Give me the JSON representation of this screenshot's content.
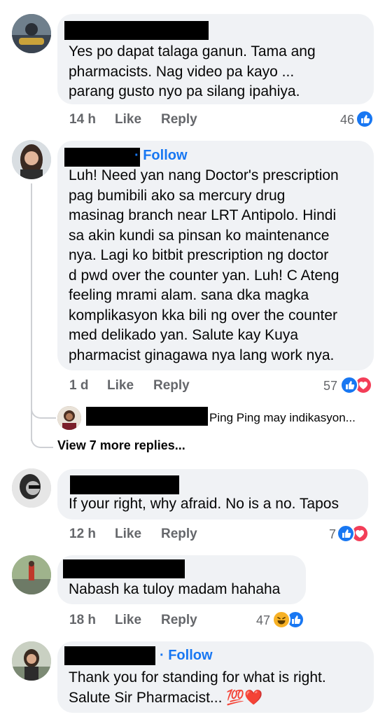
{
  "comments": [
    {
      "lines": [
        "Yes po dapat talaga ganun. Tama ang",
        "pharmacists.  Nag video pa kayo ...",
        "parang gusto nyo pa silang ipahiya."
      ],
      "time": "14 h",
      "like": "Like",
      "reply": "Reply",
      "reaction_count": "46",
      "reactions": [
        "like-icon"
      ]
    },
    {
      "follow": "· Follow",
      "lines": [
        "Luh! Need yan nang Doctor's prescription",
        "pag bumibili ako sa mercury drug",
        "masinag branch near LRT Antipolo. Hindi",
        "sa akin kundi sa pinsan ko maintenance",
        "nya. Lagi ko bitbit prescription ng doctor",
        "d pwd over the counter yan. Luh! C Ateng",
        "feeling mrami alam. sana dka magka",
        "komplikasyon kka bili ng over the counter",
        "med delikado yan. Salute kay Kuya",
        "pharmacist ginagawa nya lang work nya."
      ],
      "time": "1 d",
      "like": "Like",
      "reply": "Reply",
      "reaction_count": "57",
      "reactions": [
        "like-icon",
        "love-icon"
      ],
      "reply_preview": "Ping Ping may indikasyon...",
      "view_more": "View 7 more replies..."
    },
    {
      "lines": [
        "If your right, why afraid. No is a no. Tapos"
      ],
      "time": "12 h",
      "like": "Like",
      "reply": "Reply",
      "reaction_count": "7",
      "reactions": [
        "like-icon",
        "love-icon"
      ]
    },
    {
      "lines": [
        "Nabash ka tuloy madam hahaha"
      ],
      "time": "18 h",
      "like": "Like",
      "reply": "Reply",
      "reaction_count": "47",
      "reactions": [
        "haha-icon",
        "like-icon"
      ]
    },
    {
      "follow": "· Follow",
      "lines": [
        "Thank you for standing for what is right.",
        "Salute Sir Pharmacist... 💯❤️"
      ]
    }
  ],
  "colors": {
    "bubble": "#f0f2f5",
    "follow": "#1877f2",
    "meta": "#65676b",
    "like": "#1877f2",
    "love": "#f33e58",
    "haha": "#f7b125"
  }
}
